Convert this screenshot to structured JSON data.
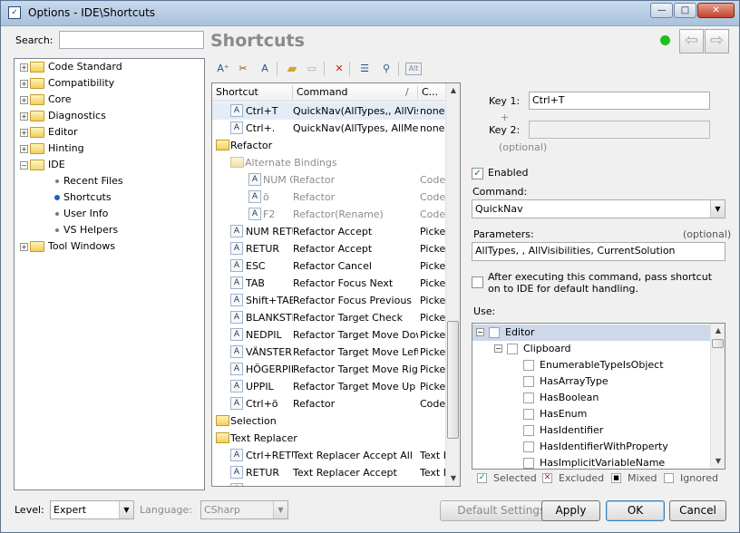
{
  "window": {
    "title": "Options - IDE\\Shortcuts",
    "buttons": [
      "—",
      "□",
      "✕"
    ]
  },
  "search": {
    "label": "Search:",
    "value": "",
    "placeholder": ""
  },
  "page_title": "Shortcuts",
  "status_color": "#1fbf1f",
  "nav": {
    "back": "⇦",
    "forward": "⇨"
  },
  "tree": [
    {
      "label": "Code Standard",
      "type": "folder",
      "expander": "+"
    },
    {
      "label": "Compatibility",
      "type": "folder",
      "expander": "+"
    },
    {
      "label": "Core",
      "type": "folder",
      "expander": "+"
    },
    {
      "label": "Diagnostics",
      "type": "folder",
      "expander": "+"
    },
    {
      "label": "Editor",
      "type": "folder",
      "expander": "+"
    },
    {
      "label": "Hinting",
      "type": "folder",
      "expander": "+"
    },
    {
      "label": "IDE",
      "type": "folder-open",
      "expander": "−"
    },
    {
      "label": "Recent Files",
      "type": "leaf"
    },
    {
      "label": "Shortcuts",
      "type": "leaf-selected"
    },
    {
      "label": "User Info",
      "type": "leaf"
    },
    {
      "label": "VS Helpers",
      "type": "leaf"
    },
    {
      "label": "Tool Windows",
      "type": "folder",
      "expander": "+"
    }
  ],
  "toolbar_icons": [
    "add-shortcut-icon",
    "add-scope-icon",
    "rename-icon",
    "add-folder-icon",
    "copy-icon",
    "delete-icon",
    "list-view-icon",
    "find-icon",
    "alt-icon"
  ],
  "grid": {
    "headers": [
      "Shortcut",
      "Command",
      "/",
      "C..."
    ],
    "rows": [
      {
        "kind": "item",
        "indent": 1,
        "sel": true,
        "shortcut": "Ctrl+T",
        "command": "QuickNav(AllTypes,, AllVisi",
        "code": "none"
      },
      {
        "kind": "item",
        "indent": 1,
        "shortcut": "Ctrl+.",
        "command": "QuickNav(AllTypes, AllMem",
        "code": "none"
      },
      {
        "kind": "folder",
        "indent": 0,
        "label": "Refactor"
      },
      {
        "kind": "folder",
        "indent": 1,
        "label": "Alternate Bindings",
        "dim": true
      },
      {
        "kind": "item",
        "indent": 2,
        "dim": true,
        "shortcut": "NUM 0",
        "command": "Refactor",
        "code": "Code"
      },
      {
        "kind": "item",
        "indent": 2,
        "dim": true,
        "shortcut": "ö",
        "command": "Refactor",
        "code": "Code"
      },
      {
        "kind": "item",
        "indent": 2,
        "dim": true,
        "shortcut": "F2",
        "command": "Refactor(Rename)",
        "code": "Code"
      },
      {
        "kind": "item",
        "indent": 1,
        "shortcut": "NUM RETUR",
        "command": "Refactor Accept",
        "code": "Picke"
      },
      {
        "kind": "item",
        "indent": 1,
        "shortcut": "RETUR",
        "command": "Refactor Accept",
        "code": "Picke"
      },
      {
        "kind": "item",
        "indent": 1,
        "shortcut": "ESC",
        "command": "Refactor Cancel",
        "code": "Picke"
      },
      {
        "kind": "item",
        "indent": 1,
        "shortcut": "TAB",
        "command": "Refactor Focus Next",
        "code": "Picke"
      },
      {
        "kind": "item",
        "indent": 1,
        "shortcut": "Shift+TAB",
        "command": "Refactor Focus Previous",
        "code": "Picke"
      },
      {
        "kind": "item",
        "indent": 1,
        "shortcut": "BLANKSTEG",
        "command": "Refactor Target Check",
        "code": "Picke"
      },
      {
        "kind": "item",
        "indent": 1,
        "shortcut": "NEDPIL",
        "command": "Refactor Target Move Down",
        "code": "Picke"
      },
      {
        "kind": "item",
        "indent": 1,
        "shortcut": "VÄNSTERPIL",
        "command": "Refactor Target Move Left",
        "code": "Picke"
      },
      {
        "kind": "item",
        "indent": 1,
        "shortcut": "HÖGERPIL",
        "command": "Refactor Target Move Right",
        "code": "Picke"
      },
      {
        "kind": "item",
        "indent": 1,
        "shortcut": "UPPIL",
        "command": "Refactor Target Move Up",
        "code": "Picke"
      },
      {
        "kind": "item",
        "indent": 1,
        "shortcut": "Ctrl+ö",
        "command": "Refactor",
        "code": "Code"
      },
      {
        "kind": "folder",
        "indent": 0,
        "label": "Selection"
      },
      {
        "kind": "folder",
        "indent": 0,
        "label": "Text Replacer"
      },
      {
        "kind": "item",
        "indent": 1,
        "shortcut": "Ctrl+RETUR",
        "command": "Text Replacer Accept All",
        "code": "Text F"
      },
      {
        "kind": "item",
        "indent": 1,
        "shortcut": "RETUR",
        "command": "Text Replacer Accept",
        "code": "Text F"
      },
      {
        "kind": "item",
        "indent": 1,
        "shortcut": "TAB",
        "command": "Text Replacer Focus Next",
        "code": "Text F"
      }
    ]
  },
  "key1": {
    "label": "Key 1:",
    "value": "Ctrl+T"
  },
  "plus": "+",
  "key2": {
    "label": "Key 2:",
    "value": "",
    "hint": "(optional)"
  },
  "enabled": {
    "label": "Enabled",
    "checked": "✓"
  },
  "command": {
    "label": "Command:",
    "value": "QuickNav"
  },
  "parameters": {
    "label": "Parameters:",
    "hint": "(optional)",
    "value": "AllTypes, , AllVisibilities, CurrentSolution"
  },
  "pass_shortcut": {
    "label": "After executing this command, pass shortcut on to IDE for default handling."
  },
  "use": {
    "label": "Use:",
    "items": [
      {
        "label": "Editor",
        "level": 0,
        "expander": "−",
        "highlight": true
      },
      {
        "label": "Clipboard",
        "level": 1,
        "expander": "−"
      },
      {
        "label": "EnumerableTypeIsObject",
        "level": 2
      },
      {
        "label": "HasArrayType",
        "level": 2
      },
      {
        "label": "HasBoolean",
        "level": 2
      },
      {
        "label": "HasEnum",
        "level": 2
      },
      {
        "label": "HasIdentifier",
        "level": 2
      },
      {
        "label": "HasIdentifierWithProperty",
        "level": 2
      },
      {
        "label": "HasImplicitVariableName",
        "level": 2
      }
    ]
  },
  "legend": {
    "selected": "Selected",
    "excluded": "Excluded",
    "mixed": "Mixed",
    "ignored": "Ignored"
  },
  "level": {
    "label": "Level:",
    "value": "Expert"
  },
  "language": {
    "label": "Language:",
    "value": "CSharp"
  },
  "buttons": {
    "default_settings": "Default Settings...",
    "apply": "Apply",
    "ok": "OK",
    "cancel": "Cancel"
  }
}
